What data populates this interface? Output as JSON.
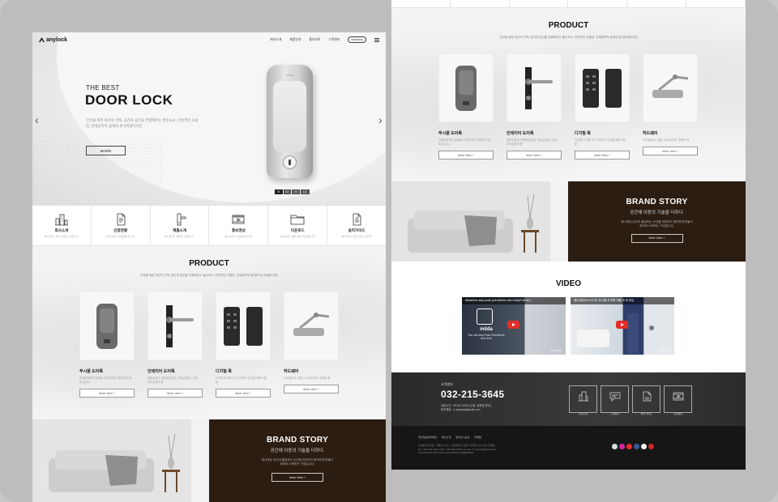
{
  "left_page": {
    "header": {
      "logo": "anylock",
      "nav": [
        "회사소개",
        "제품안내",
        "홍보자료",
        "고객센터"
      ],
      "pill": "WORKING"
    },
    "hero": {
      "subtitle": "THE BEST",
      "title": "DOOR LOCK",
      "desc": "안전을 위한 최선의 선택, 공간과 공간을 연결해주는 필수요소, 안전적인 사용감, 인체공학적 설계의 유니버셜디자인",
      "button": "MORE",
      "product_brand": "milda",
      "pager": [
        "01",
        "02",
        "03"
      ]
    },
    "quick_menu": [
      {
        "title": "회사소개",
        "sub": "애니락(주) 회사소개를 소개합니다",
        "icon": "building-icon"
      },
      {
        "title": "인증현황",
        "sub": "애니락(주) 인증현황 입니다",
        "icon": "certificate-icon"
      },
      {
        "title": "제품소개",
        "sub": "애니락(주) 제품을 소개합니다",
        "icon": "door-handle-icon"
      },
      {
        "title": "홍보영상",
        "sub": "애니락(주) 홍보영상 입니다",
        "icon": "video-icon"
      },
      {
        "title": "다운로드",
        "sub": "애니락(주) 제품 관련 자료실입니다",
        "icon": "folder-icon"
      },
      {
        "title": "설치가이드",
        "sub": "애니락(주) 설치가이드 입니다",
        "icon": "guide-icon"
      }
    ],
    "product": {
      "title": "PRODUCT",
      "desc": "안전을 위한 최선의 선택, 공간과 공간을 연결해주는 필수요소, 안전적인 사용감, 인체공학적 설계의 유니버셜디자인",
      "items": [
        {
          "name": "푸시풀 도어록",
          "desc": "인체공학적인 설계로 더 편리하고 편리한 도어록 입니다.",
          "more": "More View +"
        },
        {
          "name": "인테리어 도어록",
          "desc": "방문손잡이, 현관문손잡이, 욕실손잡이, 인테리어손잡이 등",
          "more": "More View +"
        },
        {
          "name": "디지털 록",
          "desc": "디지털 도어록 주키, 보조키, 디지털 메카니컬 등",
          "more": "More View +"
        },
        {
          "name": "하드웨어",
          "desc": "도어클로저, 경첩, 인서트/보조, 방화문 등",
          "more": "More View +"
        }
      ]
    },
    "brand_story": {
      "title": "BRAND STORY",
      "subtitle": "공간에 이동의 기술을 더하다.",
      "desc": "애니락은 당신이 출입하는 순간을 안전하고 편리하게 만들기 위하여 노력하는 기업입니다.",
      "button": "More View +"
    }
  },
  "right_page": {
    "product": {
      "title": "PRODUCT",
      "desc": "안전을 위한 최선의 선택, 공간과 공간을 연결해주는 필수요소, 안전적인 사용감, 인체공학적 설계의 유니버셜디자인",
      "items": [
        {
          "name": "푸시풀 도어록",
          "desc": "인체공학적인 설계로 더 편리하고 편리한 도어록 입니다.",
          "more": "More View +"
        },
        {
          "name": "인테리어 도어록",
          "desc": "방문손잡이, 현관문손잡이, 욕실손잡이, 인테리어손잡이 등",
          "more": "More View +"
        },
        {
          "name": "디지털 록",
          "desc": "디지털 도어록 주키, 보조키, 디지털 메카니컬 등",
          "more": "More View +"
        },
        {
          "name": "하드웨어",
          "desc": "도어클로저, 경첩, 인서트/보조, 방화문 등",
          "more": "More View +"
        }
      ]
    },
    "brand_story": {
      "title": "BRAND STORY",
      "subtitle": "공간에 이동의 기술을 더하다.",
      "desc": "애니락은 당신이 출입하는 순간을 안전하고 편리하게 만들기 위하여 노력하는 기업입니다.",
      "button": "More View +"
    },
    "video": {
      "title": "VIDEO",
      "items": [
        {
          "caption": "MildaOne-step push pull interior door lock(Full ver.)",
          "logo": "milda",
          "tagline": "The one-step Push-Pull interior door lock",
          "yt": "YouTube"
        },
        {
          "caption": "애니락(ANYLOCK) 푸시풀 도어록 제품 소개 영상",
          "logo": "",
          "tagline": "",
          "yt": "YouTube"
        }
      ]
    },
    "customer_center": {
      "label": "고객센터",
      "phone": "032-215-3645",
      "hours": "상담시간 : 09:00~18:00 (주말, 공휴일 휴무)",
      "email": "문의메일 : h.anylock@gmail.com",
      "boxes": [
        {
          "label": "회사소개",
          "icon": "building-icon"
        },
        {
          "label": "고객문의",
          "icon": "chat-icon"
        },
        {
          "label": "설치가이드",
          "icon": "guide-icon"
        },
        {
          "label": "홍보영상",
          "icon": "video-icon"
        }
      ]
    },
    "footer": {
      "links": [
        "개인정보처리방침",
        "회사소개",
        "찾아오시는길",
        "마케팅"
      ],
      "address": "(주)애니락 대표 : 이현민 | 주소 : 인천광역시 남동구 청학로 165 3층 (구월동)",
      "contact": "Tel : 032-215-3645 | Fax : 032-215-3646 | E-mail : h.anylock@gmail.com",
      "copyright": "COPYRIGHT ANYLOCK ALL RIGHTS RESERVED"
    }
  },
  "colors": {
    "brand_dark": "#2b1d12",
    "footer": "#161616",
    "accent_red": "#e52d27"
  }
}
